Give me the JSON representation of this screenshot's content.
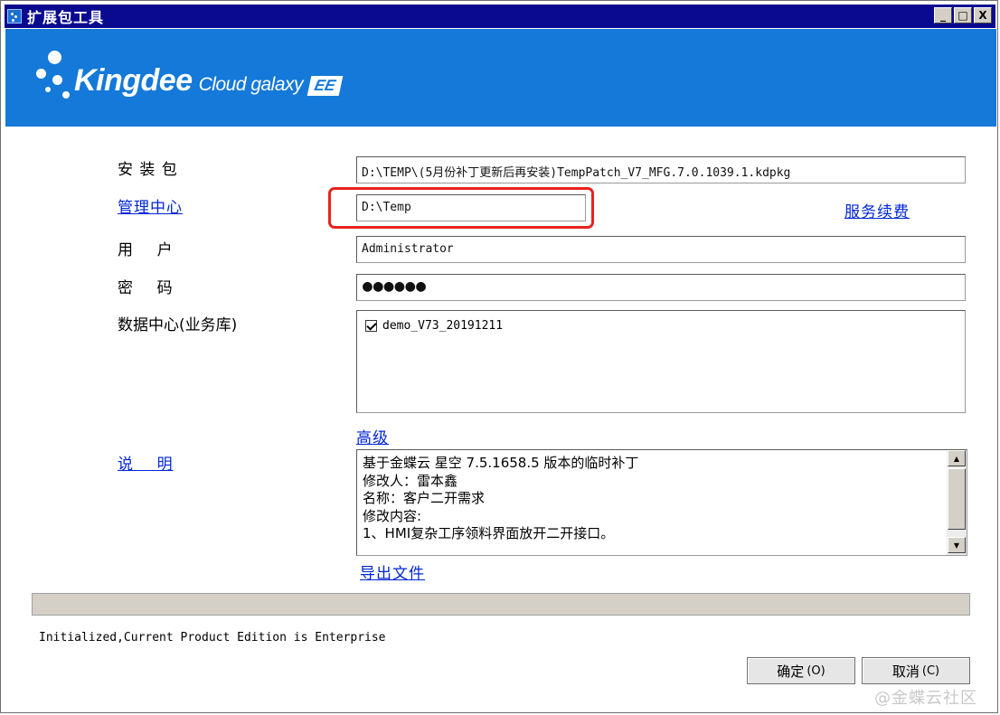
{
  "window": {
    "title": "扩展包工具",
    "buttons": [
      "_",
      "□",
      "X"
    ]
  },
  "banner": {
    "logo_main": "Kingdee",
    "logo_sub": "Cloud galaxy",
    "logo_badge": "EE",
    "color": "#1479d8"
  },
  "form": {
    "package_label": "安 装 包",
    "package_value": "D:\\TEMP\\(5月份补丁更新后再安装)TempPatch_V7_MFG.7.0.1039.1.kdpkg",
    "mgmt_label": "管理中心",
    "mgmt_value": "D:\\Temp",
    "service_link": "服务续费",
    "user_label": "用    户",
    "user_value": "Administrator",
    "password_label": "密    码",
    "password_value": "●●●●●●",
    "datacenter_label": "数据中心(业务库)",
    "datacenter_items": [
      {
        "label": "demo_V73_20191211",
        "checked": true
      }
    ],
    "advanced_link": "高级",
    "description_label": "说    明",
    "description_lines": [
      "基于金蝶云 星空 7.5.1658.5 版本的临时补丁",
      "修改人：雷本鑫",
      "名称：客户二开需求",
      "修改内容:",
      "1、HMI复杂工序领料界面放开二开接口。"
    ],
    "export_link": "导出文件"
  },
  "status": {
    "text": "Initialized,Current Product Edition is Enterprise"
  },
  "actions": {
    "ok_label": "确定",
    "ok_key": "(O)",
    "cancel_label": "取消",
    "cancel_key": "(C)"
  },
  "watermark": "@金蝶云社区",
  "colors": {
    "highlight": "#e8221f",
    "link": "#0026d6",
    "titlebar": "#0a0a90"
  }
}
